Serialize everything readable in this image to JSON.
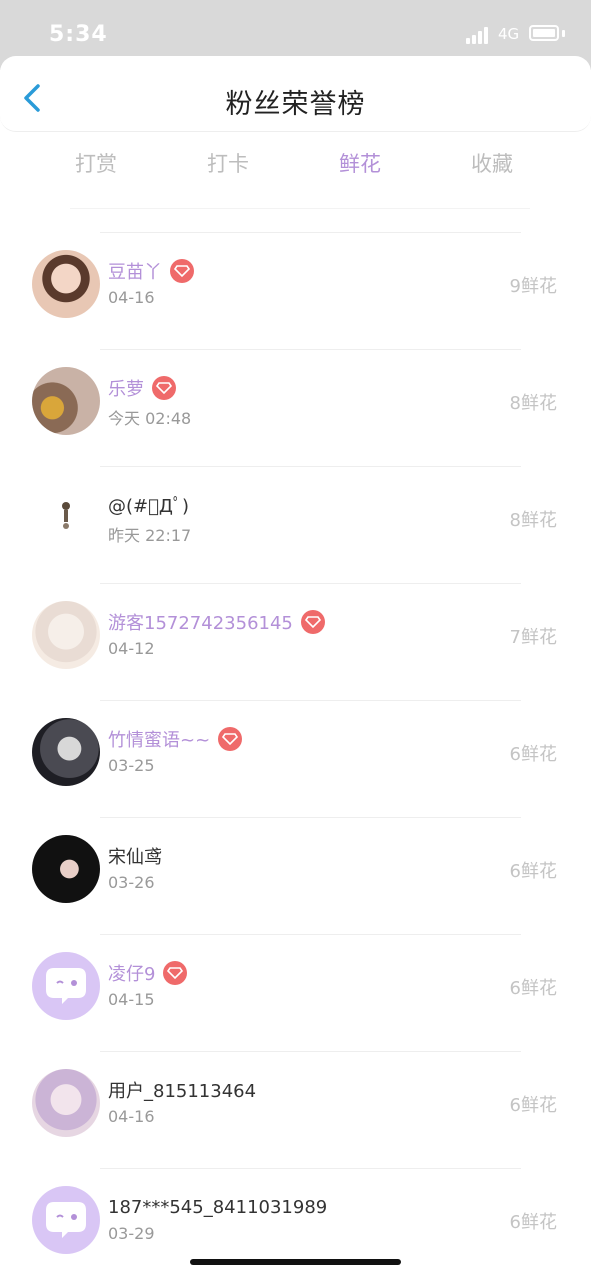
{
  "status_bar": {
    "time": "5:34",
    "network": "4G"
  },
  "header": {
    "title": "粉丝荣誉榜",
    "back_icon": "chevron-left-icon"
  },
  "tabs": [
    {
      "label": "打赏",
      "active": false
    },
    {
      "label": "打卡",
      "active": false
    },
    {
      "label": "鲜花",
      "active": true
    },
    {
      "label": "收藏",
      "active": false
    }
  ],
  "colors": {
    "accent": "#b390d8",
    "vip_badge": "#ef6a6a",
    "back": "#2a9bd8"
  },
  "fans": [
    {
      "name": "豆苗丫",
      "vip": true,
      "date": "04-16",
      "amount": "9鲜花",
      "avatar": "photo-avatar"
    },
    {
      "name": "乐萝",
      "vip": true,
      "date": "今天 02:48",
      "amount": "8鲜花",
      "avatar": "photo-avatar"
    },
    {
      "name": "@(#ﾟДﾟ)",
      "vip": false,
      "date": "昨天 22:17",
      "amount": "8鲜花",
      "avatar": "small-figure-avatar"
    },
    {
      "name": "游客1572742356145",
      "vip": true,
      "date": "04-12",
      "amount": "7鲜花",
      "avatar": "anime-avatar"
    },
    {
      "name": "竹情蜜语~~",
      "vip": true,
      "date": "03-25",
      "amount": "6鲜花",
      "avatar": "photo-avatar"
    },
    {
      "name": "宋仙鸢",
      "vip": false,
      "date": "03-26",
      "amount": "6鲜花",
      "avatar": "photo-avatar"
    },
    {
      "name": "凌仔9",
      "vip": true,
      "date": "04-15",
      "amount": "6鲜花",
      "avatar": "default-chat-avatar"
    },
    {
      "name": "用户_815113464",
      "vip": false,
      "date": "04-16",
      "amount": "6鲜花",
      "avatar": "anime-avatar"
    },
    {
      "name": "187***545_8411031989",
      "vip": false,
      "date": "03-29",
      "amount": "6鲜花",
      "avatar": "default-chat-avatar"
    }
  ]
}
